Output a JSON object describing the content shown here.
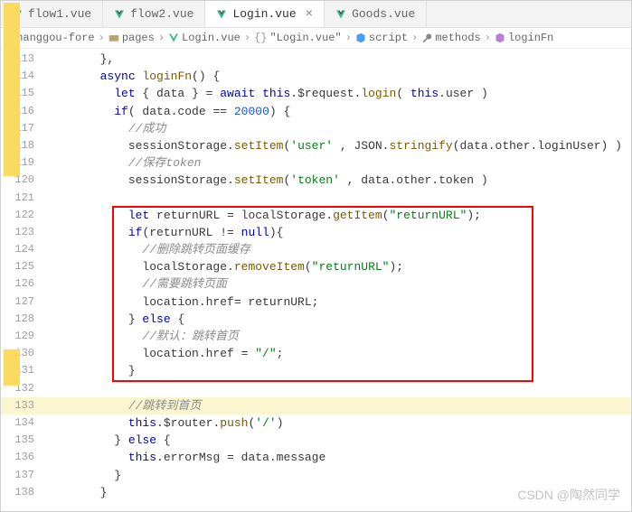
{
  "tabs": [
    {
      "label": "flow1.vue",
      "active": false,
      "close": false
    },
    {
      "label": "flow2.vue",
      "active": false,
      "close": false
    },
    {
      "label": "Login.vue",
      "active": true,
      "close": true
    },
    {
      "label": "Goods.vue",
      "active": false,
      "close": false
    }
  ],
  "breadcrumb": {
    "items": [
      "changgou-fore",
      "pages",
      "Login.vue",
      "\"Login.vue\"",
      "script",
      "methods",
      "loginFn"
    ]
  },
  "lines": {
    "start": 113,
    "end": 138
  },
  "code": {
    "l113": "       },",
    "l114_async": "async",
    "l114_fn": "loginFn",
    "l114_rest": "() {",
    "l115_let": "let",
    "l115_mid": " { data } = ",
    "l115_await": "await",
    "l115_this": "this",
    "l115_req": ".$request.",
    "l115_login": "login",
    "l115_this2": "this",
    "l115_user": ".user )",
    "l116_if": "if",
    "l116_rest": "( data.code == ",
    "l116_num": "20000",
    "l116_end": ") {",
    "l117_cmt": "//成功",
    "l118_a": "           sessionStorage.",
    "l118_fn": "setItem",
    "l118_s1": "'user'",
    "l118_mid": " , JSON.",
    "l118_fn2": "stringify",
    "l118_end": "(data.other.loginUser) )",
    "l119_cmt": "//保存token",
    "l120_a": "           sessionStorage.",
    "l120_fn": "setItem",
    "l120_s1": "'token'",
    "l120_end": " , data.other.token )",
    "l122_let": "let",
    "l122_mid": " returnURL = localStorage.",
    "l122_fn": "getItem",
    "l122_s": "\"returnURL\"",
    "l123_if": "if",
    "l123_cond": "(returnURL != ",
    "l123_null": "null",
    "l123_end": "){",
    "l124_cmt": "//删除跳转页面缓存",
    "l125_a": "             localStorage.",
    "l125_fn": "removeItem",
    "l125_s": "\"returnURL\"",
    "l126_cmt": "//需要跳转页面",
    "l127": "             location.href= returnURL;",
    "l128_else": "else",
    "l129_cmt": "//默认：跳转首页",
    "l130_a": "             location.href = ",
    "l130_s": "\"/\"",
    "l131": "           }",
    "l133_cmt": "//跳转到首页",
    "l134_this": "this",
    "l134_mid": ".$router.",
    "l134_fn": "push",
    "l134_s": "'/'",
    "l135_else": "else",
    "l136_this": "this",
    "l136_rest": ".errorMsg = data.message",
    "l137": "         }",
    "l138": "       }"
  },
  "watermark": "CSDN @陶然同学"
}
